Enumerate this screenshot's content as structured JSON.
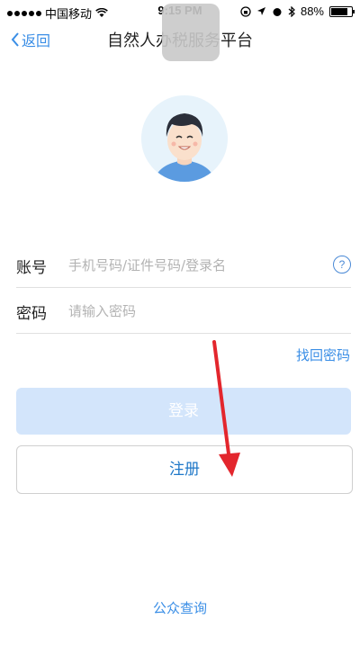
{
  "status_bar": {
    "carrier": "中国移动",
    "time": "9:15 PM",
    "battery": "88%",
    "battery_level": 0.88
  },
  "nav": {
    "back_label": "返回",
    "title": "自然人办税服务平台"
  },
  "form": {
    "account_label": "账号",
    "account_placeholder": "手机号码/证件号码/登录名",
    "password_label": "密码",
    "password_placeholder": "请输入密码",
    "help_icon": "?",
    "forgot_password": "找回密码"
  },
  "buttons": {
    "login": "登录",
    "register": "注册"
  },
  "footer": {
    "public_query": "公众查询"
  },
  "colors": {
    "accent": "#3a8ee6",
    "login_disabled": "#d3e5fb",
    "annotation_arrow": "#e3262d"
  }
}
